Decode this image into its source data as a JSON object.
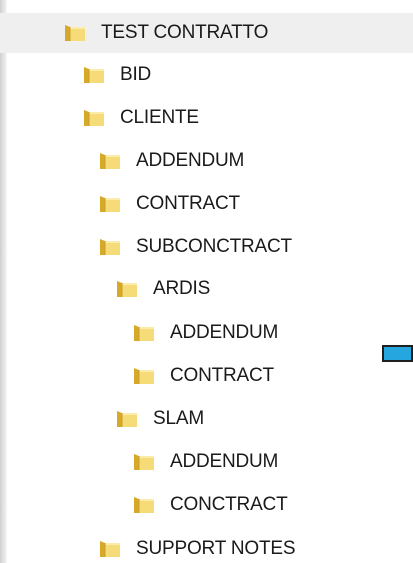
{
  "tree": {
    "items": [
      {
        "label": "TEST CONTRATTO",
        "icon": "folder-icon",
        "depth": 0
      },
      {
        "label": "BID",
        "icon": "folder-icon",
        "depth": 1
      },
      {
        "label": "CLIENTE",
        "icon": "folder-icon",
        "depth": 1
      },
      {
        "label": "ADDENDUM",
        "icon": "folder-icon",
        "depth": 2
      },
      {
        "label": "CONTRACT",
        "icon": "folder-icon",
        "depth": 2
      },
      {
        "label": "SUBCONCTRACT",
        "icon": "folder-icon",
        "depth": 2
      },
      {
        "label": "ARDIS",
        "icon": "folder-icon",
        "depth": 3
      },
      {
        "label": "ADDENDUM",
        "icon": "folder-icon",
        "depth": 4
      },
      {
        "label": "CONTRACT",
        "icon": "folder-icon",
        "depth": 4
      },
      {
        "label": "SLAM",
        "icon": "folder-icon",
        "depth": 3
      },
      {
        "label": "ADDENDUM",
        "icon": "folder-icon",
        "depth": 4
      },
      {
        "label": "CONCTRACT",
        "icon": "folder-icon",
        "depth": 4
      },
      {
        "label": "SUPPORT NOTES",
        "icon": "folder-icon",
        "depth": 2
      }
    ]
  },
  "colors": {
    "folder_light": "#f6dc78",
    "folder_dark": "#d7a928",
    "selection_bg": "#efefef",
    "marker_blue": "#26a6df"
  }
}
